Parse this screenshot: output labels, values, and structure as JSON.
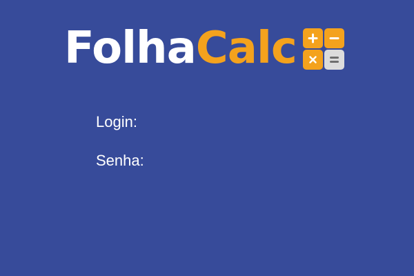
{
  "logo": {
    "part1": "Folha",
    "part2": "Calc",
    "icon": "calculator-icon",
    "colors": {
      "part1": "#ffffff",
      "part2": "#f4a21d",
      "icon_keys": "#f4a21d",
      "icon_equals": "#dcdcdc"
    }
  },
  "form": {
    "login_label": "Login:",
    "login_value": "",
    "senha_label": "Senha:",
    "senha_value": ""
  },
  "colors": {
    "background": "#374b9a",
    "text": "#ffffff"
  }
}
